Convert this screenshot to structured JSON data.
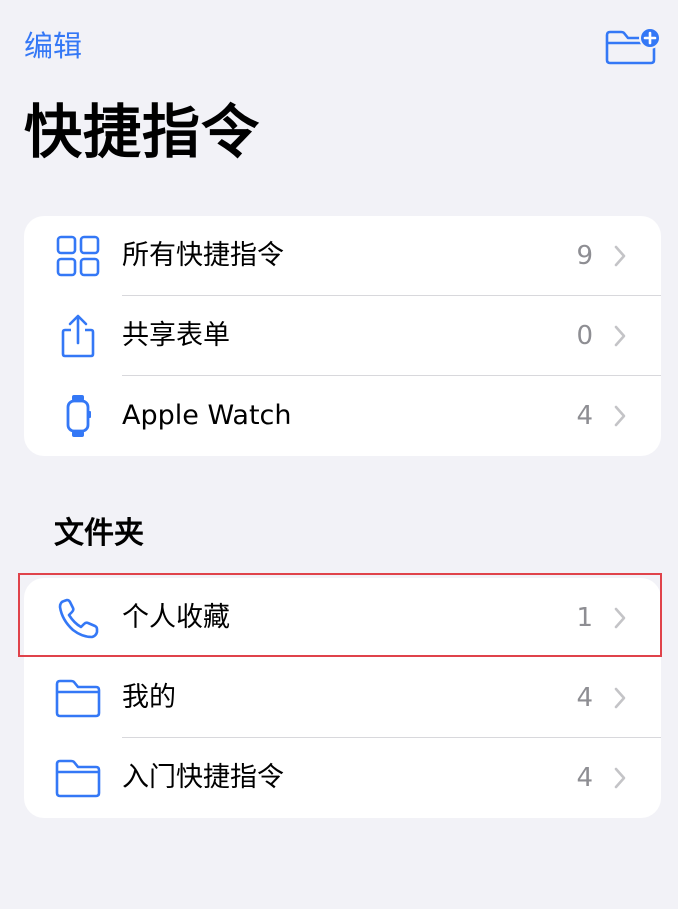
{
  "header": {
    "edit_label": "编辑",
    "new_folder_icon": "folder-plus-icon",
    "title": "快捷指令"
  },
  "library": {
    "items": [
      {
        "label": "所有快捷指令",
        "count": "9",
        "icon": "grid-icon"
      },
      {
        "label": "共享表单",
        "count": "0",
        "icon": "share-icon"
      },
      {
        "label": "Apple Watch",
        "count": "4",
        "icon": "watch-icon"
      }
    ]
  },
  "folders": {
    "header": "文件夹",
    "items": [
      {
        "label": "个人收藏",
        "count": "1",
        "icon": "phone-icon",
        "highlighted": true
      },
      {
        "label": "我的",
        "count": "4",
        "icon": "folder-icon"
      },
      {
        "label": "入门快捷指令",
        "count": "4",
        "icon": "folder-icon"
      }
    ]
  },
  "colors": {
    "accent": "#3478f6",
    "background": "#f2f2f7",
    "card": "#ffffff",
    "secondary_text": "#8e8e93",
    "highlight_border": "#e0434b"
  }
}
